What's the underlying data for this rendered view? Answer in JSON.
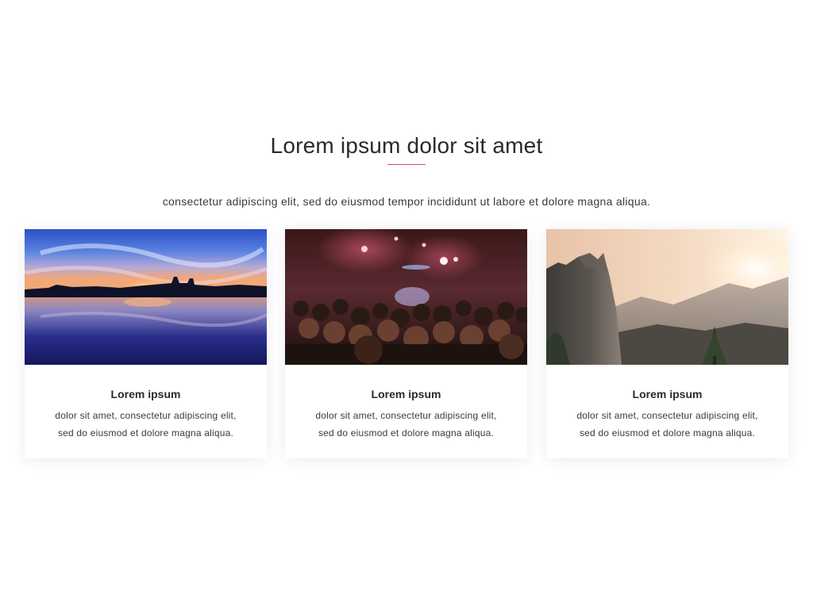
{
  "section": {
    "title": "Lorem ipsum dolor sit amet",
    "subtitle": "consectetur adipiscing elit, sed do eiusmod tempor incididunt ut labore et dolore magna aliqua.",
    "accent_color": "#d0467a"
  },
  "cards": [
    {
      "image": "sunset-lake-photo",
      "title": "Lorem ipsum",
      "text_line1": "dolor sit amet, consectetur adipiscing elit,",
      "text_line2": "sed do eiusmod et dolore magna aliqua."
    },
    {
      "image": "concert-crowd-photo",
      "title": "Lorem ipsum",
      "text_line1": "dolor sit amet, consectetur adipiscing elit,",
      "text_line2": "sed do eiusmod et dolore magna aliqua."
    },
    {
      "image": "mountain-cliff-photo",
      "title": "Lorem ipsum",
      "text_line1": "dolor sit amet, consectetur adipiscing elit,",
      "text_line2": "sed do eiusmod et dolore magna aliqua."
    }
  ]
}
